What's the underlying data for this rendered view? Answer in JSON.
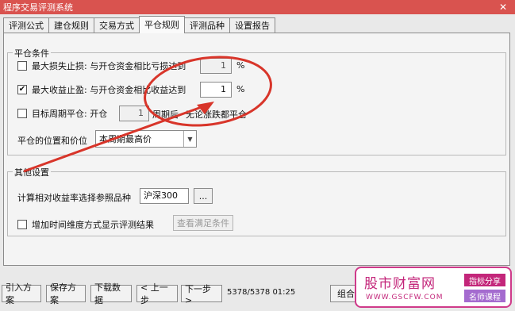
{
  "window": {
    "title": "程序交易评测系统",
    "close_glyph": "✕"
  },
  "tabs": [
    "评测公式",
    "建仓规则",
    "交易方式",
    "平仓规则",
    "评测品种",
    "设置报告"
  ],
  "close_conditions": {
    "group_title": "平仓条件",
    "stop_loss": {
      "label": "最大损失止损: 与开仓资金相比亏损达到",
      "value": "1",
      "unit": "%",
      "checked": false
    },
    "take_profit": {
      "label": "最大收益止盈: 与开仓资金相比收益达到",
      "value": "1",
      "unit": "%",
      "checked": true
    },
    "target_period": {
      "label": "目标周期平仓: 开仓",
      "value": "1",
      "suffix": "周期后",
      "note": "无论涨跌都平仓",
      "checked": false
    },
    "position_price": {
      "label": "平仓的位置和价位",
      "selected": "本周期最高价"
    }
  },
  "other_settings": {
    "group_title": "其他设置",
    "benchmark": {
      "label": "计算相对收益率选择参照品种",
      "value": "沪深300",
      "browse": "..."
    },
    "time_dimension": {
      "label": "增加时间维度方式显示评测结果",
      "checked": false,
      "button": "查看满足条件"
    }
  },
  "bottom": {
    "buttons": [
      "引入方案",
      "保存方案",
      "下载数据",
      "< 上一步",
      "下一步 >",
      "组合"
    ],
    "status": "5378/5378 01:25"
  },
  "watermark": {
    "main": "股市财富网",
    "url": "WWW.GSCFW.COM",
    "tag1": "指标分享",
    "tag2": "名师课程"
  },
  "colors": {
    "title_bar": "#d9534f",
    "annotation": "#d8352a",
    "watermark": "#c3267a"
  }
}
